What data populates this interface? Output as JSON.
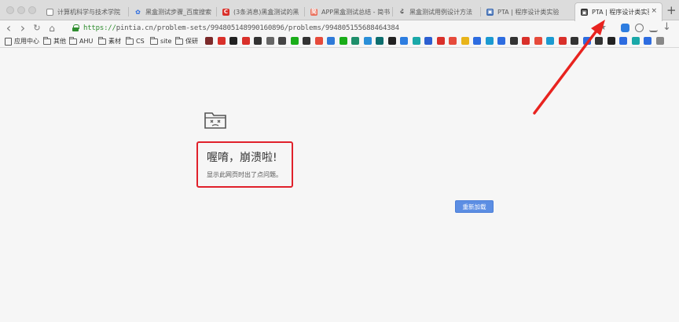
{
  "tabs": [
    {
      "title": "计算机科学与技术学院",
      "icon": "document-icon",
      "color": "#8a8a8a"
    },
    {
      "title": "黑盒测试步骤_百度搜索",
      "icon": "baidu-paw-icon",
      "color": "#2d6ce0"
    },
    {
      "title": "(3条消息)黑盒测试的黑",
      "icon": "csdn-icon",
      "color": "#d9302a"
    },
    {
      "title": "APP黑盒测试总结 - 简书",
      "icon": "jianshu-icon",
      "color": "#ea6f5a"
    },
    {
      "title": "黑盒测试用例设计方法",
      "icon": "brand-icon",
      "color": "#555555"
    },
    {
      "title": "PTA | 程序设计类实验",
      "icon": "pta-icon",
      "color": "#3f6db3"
    },
    {
      "title": "PTA | 程序设计类实验辅",
      "icon": "pta-icon",
      "color": "#333333",
      "active": true
    }
  ],
  "tab_close_glyph": "×",
  "new_tab_glyph": "+",
  "toolbar": {
    "back_glyph": "‹",
    "forward_glyph": "›",
    "reload_glyph": "↻",
    "home_glyph": "⌂",
    "url_scheme": "https://",
    "url_rest": "pintia.cn/problem-sets/994805148990160896/problems/994805155688464384",
    "star_glyph": "★"
  },
  "bookmarks": {
    "items": [
      {
        "label": "应用中心",
        "icon": "apps-icon"
      },
      {
        "label": "其他",
        "icon": "folder-icon"
      },
      {
        "label": "AHU",
        "icon": "folder-icon"
      },
      {
        "label": "素材",
        "icon": "folder-icon"
      },
      {
        "label": "CS",
        "icon": "folder-icon"
      },
      {
        "label": "site",
        "icon": "folder-icon"
      },
      {
        "label": "保研",
        "icon": "folder-icon"
      }
    ],
    "icon_colors": [
      "#7b2a2a",
      "#d9302a",
      "#222222",
      "#d9302a",
      "#333333",
      "#666666",
      "#444444",
      "#1aad19",
      "#333333",
      "#e64a3b",
      "#2f7ad8",
      "#1aad19",
      "#1f8f6b",
      "#2a8fd8",
      "#0d6e6e",
      "#222222",
      "#2d7de0",
      "#1aa8a8",
      "#2c5fd1",
      "#d9302a",
      "#e64a3b",
      "#e8b41a",
      "#2d6ce0",
      "#1b9ad1",
      "#2d6ce0",
      "#333333",
      "#d9302a",
      "#e64a3b",
      "#1b9ad1",
      "#d9302a",
      "#333333",
      "#2d6ce0",
      "#333333",
      "#222222",
      "#2d6ce0",
      "#1aa8a8",
      "#2d6ce0",
      "#888888"
    ]
  },
  "error_page": {
    "title": "喔唷，崩溃啦!",
    "description": "显示此网页时出了点问题。",
    "reload_label": "重新加载",
    "icon": "sad-tab-icon"
  },
  "colors": {
    "accent": "#5c8ee3",
    "highlight": "#e0212b",
    "secure": "#2f8d2f"
  }
}
